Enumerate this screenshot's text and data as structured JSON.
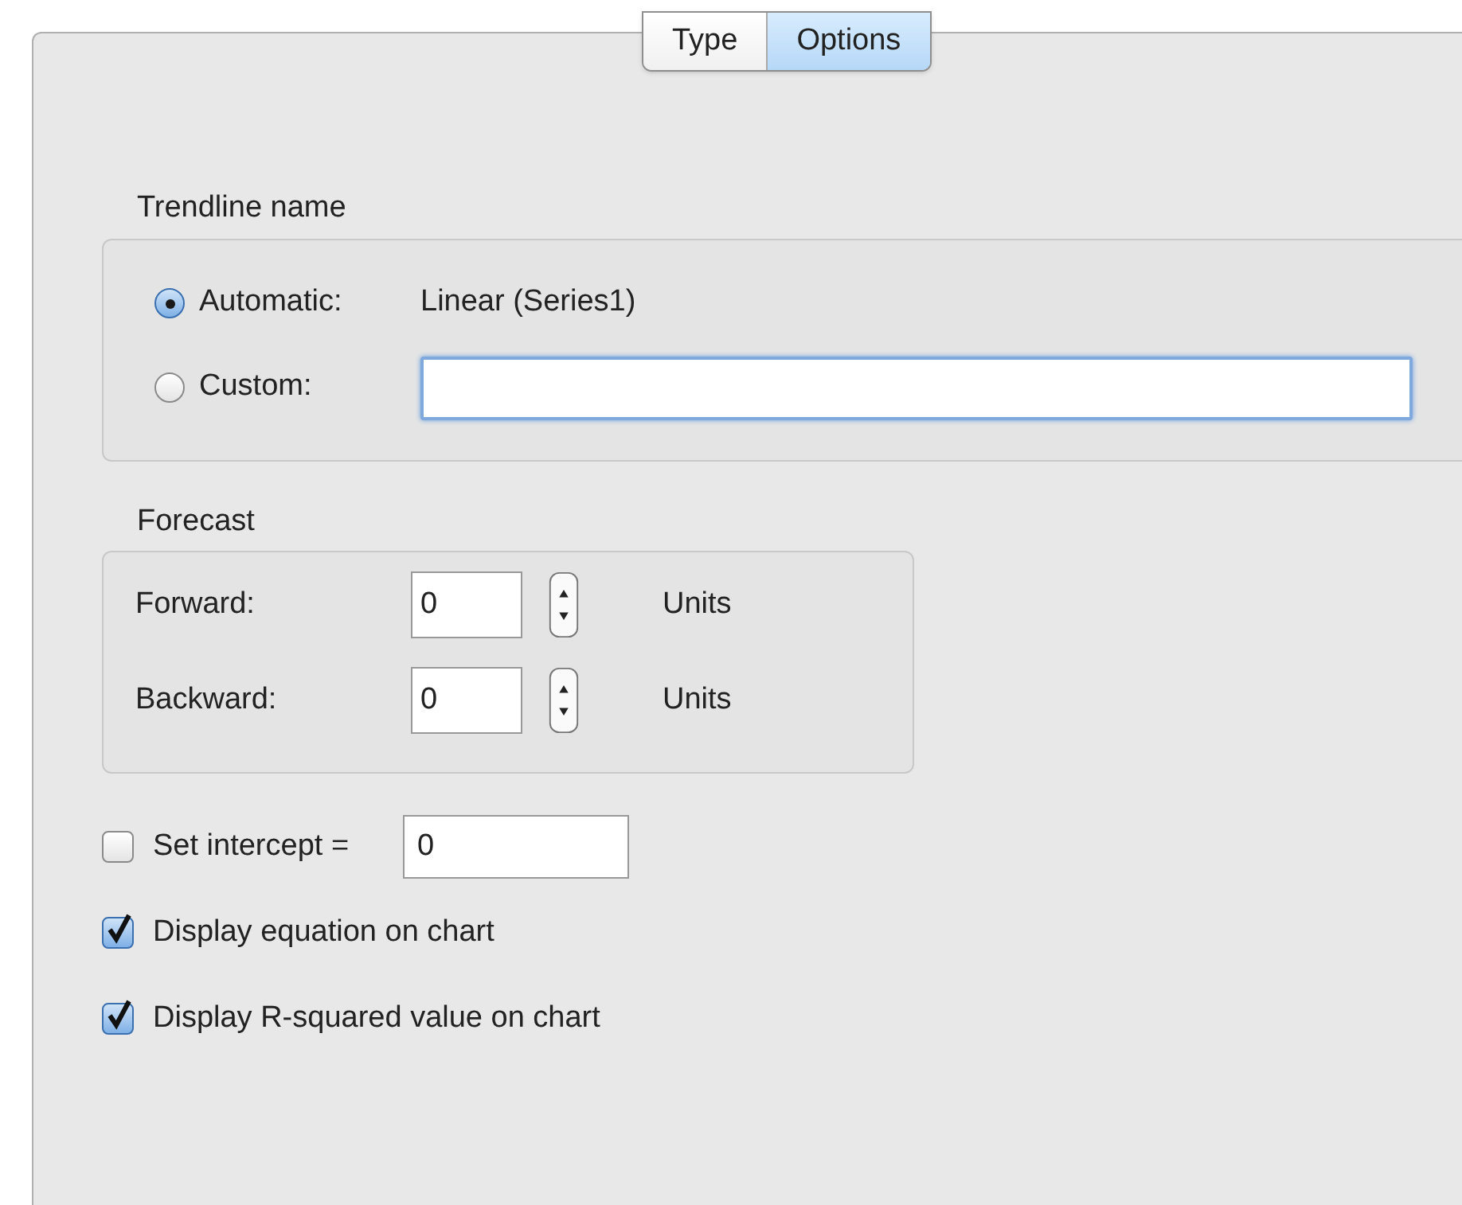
{
  "tabs": [
    {
      "label": "Type",
      "selected": false
    },
    {
      "label": "Options",
      "selected": true
    }
  ],
  "trendline_name": {
    "title": "Trendline name",
    "options": [
      {
        "label": "Automatic:",
        "selected": true,
        "kind": "text",
        "value": "Linear (Series1)"
      },
      {
        "label": "Custom:",
        "selected": false,
        "kind": "field"
      }
    ]
  },
  "forecast": {
    "title": "Forecast",
    "rows": [
      {
        "label": "Forward:",
        "value": "0",
        "unit": "Units"
      },
      {
        "label": "Backward:",
        "value": "0",
        "unit": "Units"
      }
    ]
  },
  "options": [
    {
      "label": "Set intercept =",
      "checked": false,
      "kind": "field",
      "value": "0"
    },
    {
      "label": "Display equation on chart",
      "checked": true,
      "kind": "plain"
    },
    {
      "label": "Display R-squared value on chart",
      "checked": true,
      "kind": "plain"
    }
  ]
}
